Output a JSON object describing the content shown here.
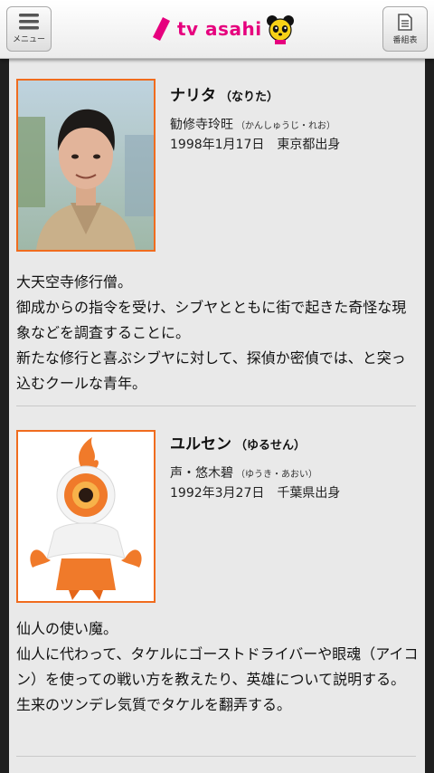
{
  "header": {
    "menu_label": "メニュー",
    "logo_text": "tv asahi",
    "guide_label": "番組表"
  },
  "characters": [
    {
      "name": "ナリタ",
      "name_kana": "（なりた）",
      "actor": "勧修寺玲旺",
      "actor_kana": "（かんしゅうじ・れお）",
      "birth": "1998年1月17日　東京都出身",
      "description": [
        "大天空寺修行僧。",
        "御成からの指令を受け、シブヤとともに街で起きた奇怪な現象などを調査することに。",
        "新たな修行と喜ぶシブヤに対して、探偵か密偵では、と突っ込むクールな青年。"
      ]
    },
    {
      "name": "ユルセン",
      "name_kana": "（ゆるせん）",
      "actor": "声・悠木碧",
      "actor_kana": "（ゆうき・あおい）",
      "birth": "1992年3月27日　千葉県出身",
      "description": [
        "仙人の使い魔。",
        "仙人に代わって、タケルにゴーストドライバーや眼魂（アイコン）を使っての戦い方を教えたり、英雄について説明する。",
        "生来のツンデレ気質でタケルを翻弄する。"
      ]
    }
  ],
  "colors": {
    "accent_orange": "#f06c1e",
    "brand_pink": "#e6007e",
    "panel_bg": "#e9e9e9"
  }
}
